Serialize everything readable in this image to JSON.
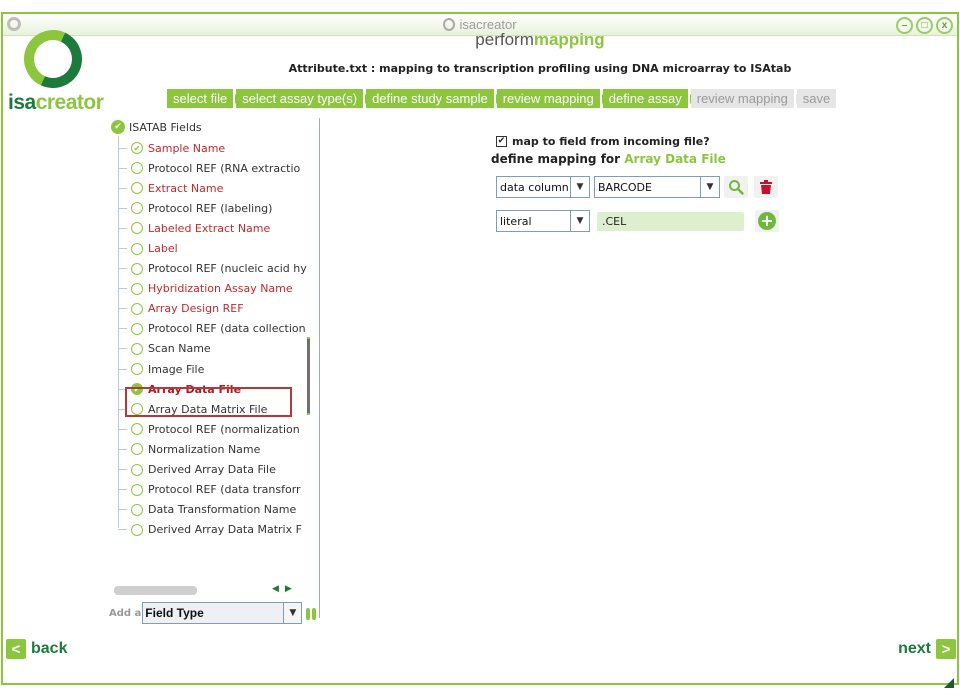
{
  "window": {
    "title": "isacreator",
    "controls": [
      "minimize",
      "maximize",
      "close"
    ]
  },
  "logo": {
    "part1": "isa",
    "part2": "creator"
  },
  "heading": {
    "prefix": "perform",
    "accent": "mapping"
  },
  "subtitle": "Attribute.txt : mapping to transcription profiling using DNA microarray to ISAtab",
  "steps": [
    {
      "label": "select file",
      "state": "done"
    },
    {
      "label": "select assay type(s)",
      "state": "done"
    },
    {
      "label": "define study sample",
      "state": "done"
    },
    {
      "label": "review mapping",
      "state": "done"
    },
    {
      "label": "define assay",
      "state": "done"
    },
    {
      "label": "review mapping",
      "state": "todo"
    },
    {
      "label": "save",
      "state": "todo"
    }
  ],
  "tree": {
    "root": "ISATAB Fields",
    "items": [
      {
        "label": "Sample Name",
        "required": true,
        "mapped": true
      },
      {
        "label": "Protocol REF (RNA extractio",
        "required": false,
        "mapped": false
      },
      {
        "label": "Extract Name",
        "required": true,
        "mapped": false
      },
      {
        "label": "Protocol REF (labeling)",
        "required": false,
        "mapped": false
      },
      {
        "label": "Labeled Extract Name",
        "required": true,
        "mapped": false
      },
      {
        "label": "Label",
        "required": true,
        "mapped": false
      },
      {
        "label": "Protocol REF (nucleic acid hy",
        "required": false,
        "mapped": false
      },
      {
        "label": "Hybridization Assay Name",
        "required": true,
        "mapped": false
      },
      {
        "label": "Array Design REF",
        "required": true,
        "mapped": false
      },
      {
        "label": "Protocol REF (data collection",
        "required": false,
        "mapped": false
      },
      {
        "label": "Scan Name",
        "required": false,
        "mapped": false
      },
      {
        "label": "Image File",
        "required": false,
        "mapped": false
      },
      {
        "label": "Array Data File",
        "required": true,
        "mapped": true,
        "selected": true
      },
      {
        "label": "Array Data Matrix File",
        "required": false,
        "mapped": false
      },
      {
        "label": "Protocol REF (normalization",
        "required": false,
        "mapped": false
      },
      {
        "label": "Normalization Name",
        "required": false,
        "mapped": false
      },
      {
        "label": "Derived Array Data File",
        "required": false,
        "mapped": false
      },
      {
        "label": "Protocol REF (data transforr",
        "required": false,
        "mapped": false
      },
      {
        "label": "Data Transformation Name",
        "required": false,
        "mapped": false
      },
      {
        "label": "Derived Array Data Matrix F",
        "required": false,
        "mapped": false
      }
    ]
  },
  "add_field": {
    "label": "Add a",
    "select_value": "Field Type"
  },
  "mapping": {
    "checkbox_label": "map to field from incoming file?",
    "checkbox_checked": true,
    "define_prefix": "define mapping for",
    "define_field": "Array Data File",
    "row1": {
      "type": "data column",
      "value": "BARCODE"
    },
    "row2": {
      "type": "literal",
      "value": ".CEL"
    }
  },
  "nav": {
    "back": "back",
    "next": "next"
  },
  "colors": {
    "accent": "#8cc63f",
    "dark_green": "#1e7a3c",
    "required": "#c0292e",
    "selection_border": "#b23a3a"
  }
}
